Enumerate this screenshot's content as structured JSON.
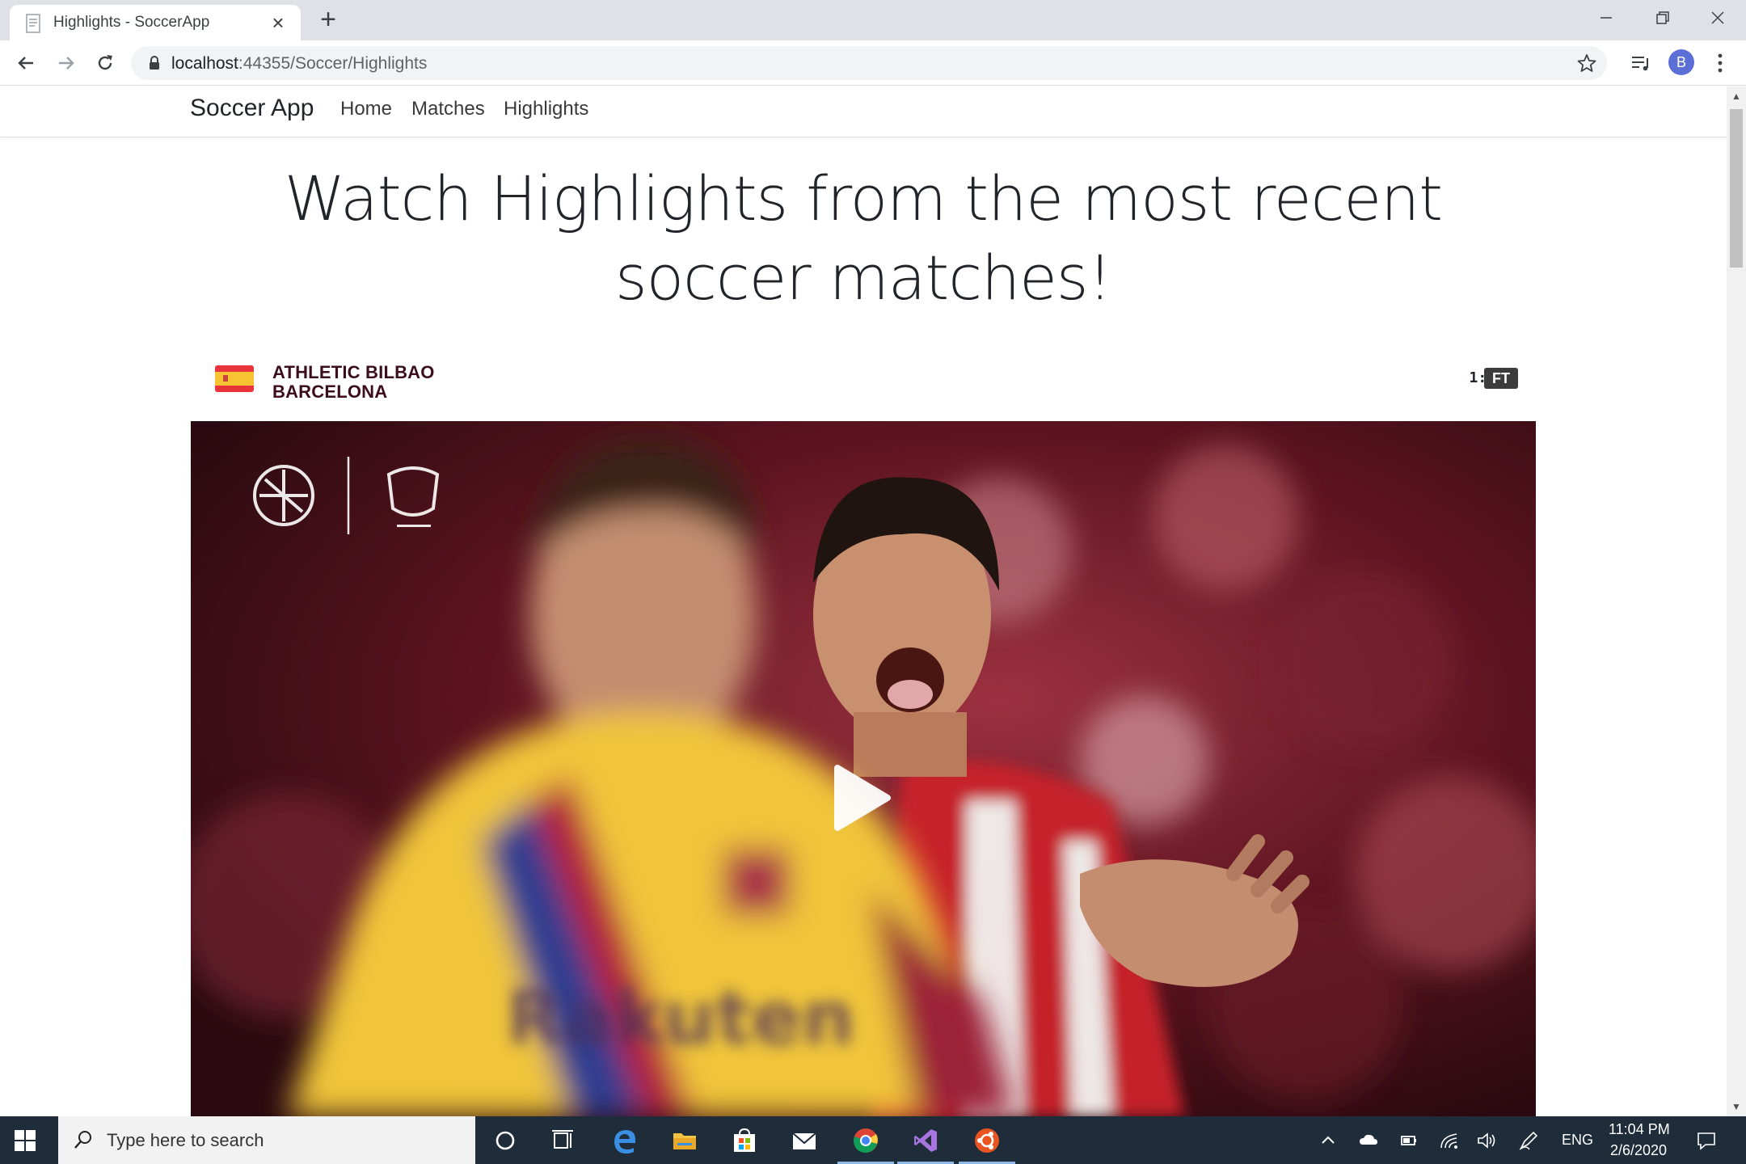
{
  "browser": {
    "tab_title": "Highlights - SoccerApp",
    "url_host": "localhost",
    "url_rest": ":44355/Soccer/Highlights",
    "profile_initial": "B"
  },
  "app": {
    "brand": "Soccer App",
    "nav": [
      "Home",
      "Matches",
      "Highlights"
    ]
  },
  "page": {
    "heading": "Watch Highlights from the most recent soccer matches!"
  },
  "match": {
    "home_team": "ATHLETIC BILBAO",
    "away_team": "BARCELONA",
    "score": "1:0",
    "status": "FT",
    "flag": "spain-flag"
  },
  "video": {
    "thumbnail_description_icon": "play-icon"
  },
  "taskbar": {
    "search_placeholder": "Type here to search",
    "language": "ENG",
    "time": "11:04 PM",
    "date": "2/6/2020"
  },
  "colors": {
    "tab_strip": "#dee1e6",
    "team_text": "#3b0d1d",
    "taskbar": "#1f2c3a",
    "avatar": "#5b6fd6"
  }
}
